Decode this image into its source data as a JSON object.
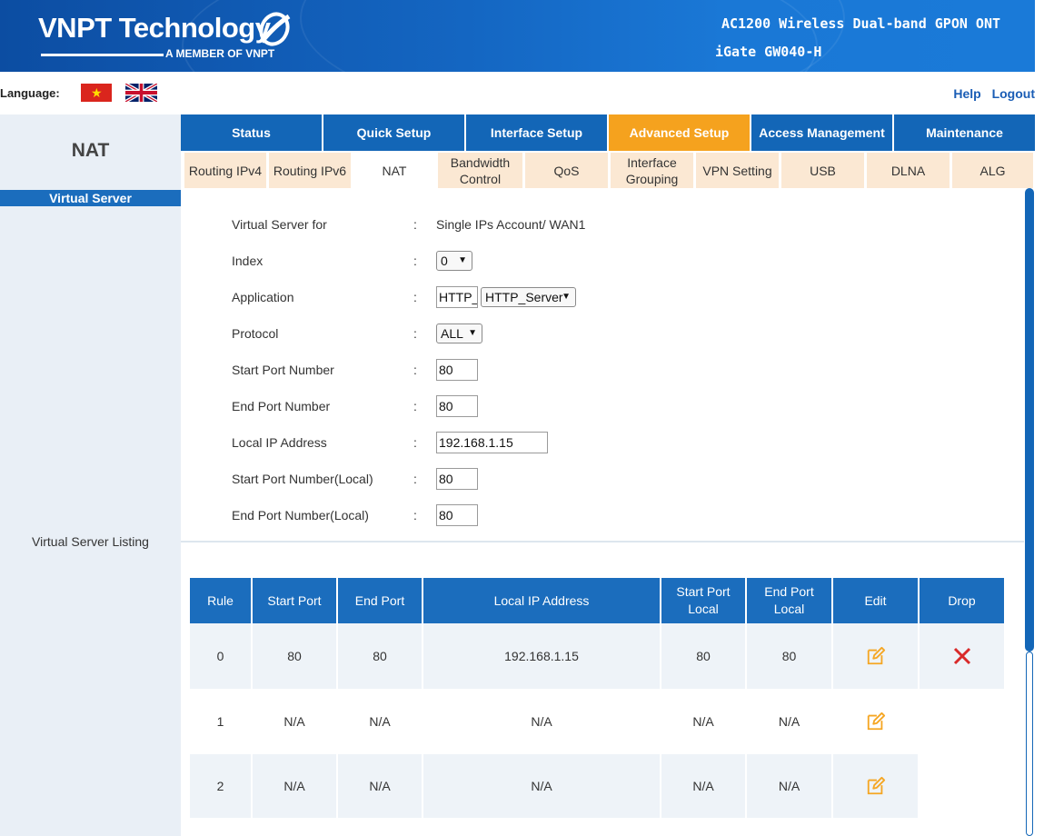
{
  "header": {
    "logo_text": "VNPT Technology",
    "logo_sub": "A MEMBER OF VNPT",
    "model_line1": "AC1200 Wireless Dual-band GPON ONT",
    "model_line2": "iGate GW040-H"
  },
  "language": {
    "label": "Language:",
    "flags": [
      "vietnam-flag-icon",
      "uk-flag-icon"
    ]
  },
  "top_links": {
    "help": "Help",
    "logout": "Logout"
  },
  "sidebar": {
    "title": "NAT",
    "active_item": "Virtual Server",
    "listing_label": "Virtual Server Listing"
  },
  "main_tabs": [
    {
      "label": "Status",
      "active": false
    },
    {
      "label": "Quick Setup",
      "active": false
    },
    {
      "label": "Interface Setup",
      "active": false
    },
    {
      "label": "Advanced Setup",
      "active": true
    },
    {
      "label": "Access Management",
      "active": false
    },
    {
      "label": "Maintenance",
      "active": false
    }
  ],
  "sub_tabs": [
    {
      "line1": "Routing IPv4",
      "line2": ""
    },
    {
      "line1": "Routing IPv6",
      "line2": ""
    },
    {
      "line1": "NAT",
      "line2": ""
    },
    {
      "line1": "Bandwidth",
      "line2": "Control"
    },
    {
      "line1": "QoS",
      "line2": ""
    },
    {
      "line1": "Interface",
      "line2": "Grouping"
    },
    {
      "line1": "VPN Setting",
      "line2": ""
    },
    {
      "line1": "USB",
      "line2": ""
    },
    {
      "line1": "DLNA",
      "line2": ""
    },
    {
      "line1": "ALG",
      "line2": ""
    }
  ],
  "form": {
    "colon": ":",
    "virtual_server_for": {
      "label": "Virtual Server for",
      "value": "Single IPs Account/ WAN1"
    },
    "index": {
      "label": "Index",
      "value": "0"
    },
    "application": {
      "label": "Application",
      "text_value": "HTTP_",
      "select_value": "HTTP_Server"
    },
    "protocol": {
      "label": "Protocol",
      "value": "ALL"
    },
    "start_port": {
      "label": "Start Port Number",
      "value": "80"
    },
    "end_port": {
      "label": "End Port Number",
      "value": "80"
    },
    "local_ip": {
      "label": "Local IP Address",
      "value": "192.168.1.15"
    },
    "start_port_local": {
      "label": "Start Port Number(Local)",
      "value": "80"
    },
    "end_port_local": {
      "label": "End Port Number(Local)",
      "value": "80"
    }
  },
  "table": {
    "headers": [
      "Rule",
      "Start Port",
      "End Port",
      "Local IP Address",
      "Start Port Local",
      "End Port Local",
      "Edit",
      "Drop"
    ],
    "header_lines": [
      [
        "Rule",
        ""
      ],
      [
        "Start Port",
        ""
      ],
      [
        "End Port",
        ""
      ],
      [
        "Local IP Address",
        ""
      ],
      [
        "Start Port",
        "Local"
      ],
      [
        "End Port",
        "Local"
      ],
      [
        "Edit",
        ""
      ],
      [
        "Drop",
        ""
      ]
    ],
    "rows": [
      {
        "rule": "0",
        "start_port": "80",
        "end_port": "80",
        "local_ip": "192.168.1.15",
        "start_port_local": "80",
        "end_port_local": "80",
        "edit": "edit-icon",
        "drop": "delete-x-icon"
      },
      {
        "rule": "1",
        "start_port": "N/A",
        "end_port": "N/A",
        "local_ip": "N/A",
        "start_port_local": "N/A",
        "end_port_local": "N/A",
        "edit": "edit-icon",
        "drop": ""
      },
      {
        "rule": "2",
        "start_port": "N/A",
        "end_port": "N/A",
        "local_ip": "N/A",
        "start_port_local": "N/A",
        "end_port_local": "N/A",
        "edit": "edit-icon",
        "drop": ""
      }
    ]
  },
  "colors": {
    "primary_blue": "#1366b7",
    "active_tab_orange": "#f5a21e",
    "subtab_peach": "#fbe8d3",
    "edit_icon_orange": "#f5a623",
    "drop_icon_red": "#d92a2a"
  }
}
